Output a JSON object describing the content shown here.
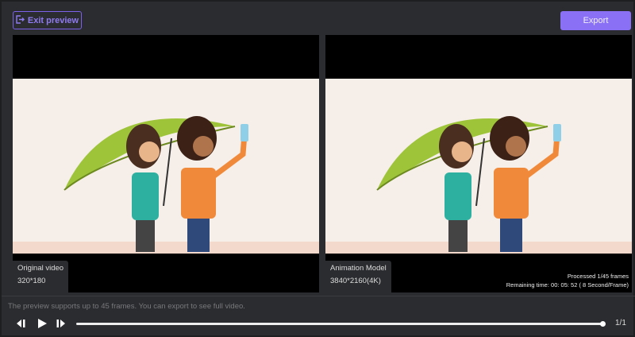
{
  "header": {
    "exit_label": "Exit preview",
    "export_label": "Export"
  },
  "left_panel": {
    "title": "Original video",
    "resolution": "320*180"
  },
  "right_panel": {
    "title": "Animation Model",
    "resolution": "3840*2160(4K)",
    "processed": "Processed 1/45 frames",
    "remaining": "Remaining time: 00: 05: 52 ( 8 Second/Frame)"
  },
  "footer": {
    "note": "The preview supports up to 45 frames. You can export to see full video.",
    "page": "1/1",
    "progress": 1.0
  },
  "colors": {
    "accent": "#8a70f4"
  }
}
